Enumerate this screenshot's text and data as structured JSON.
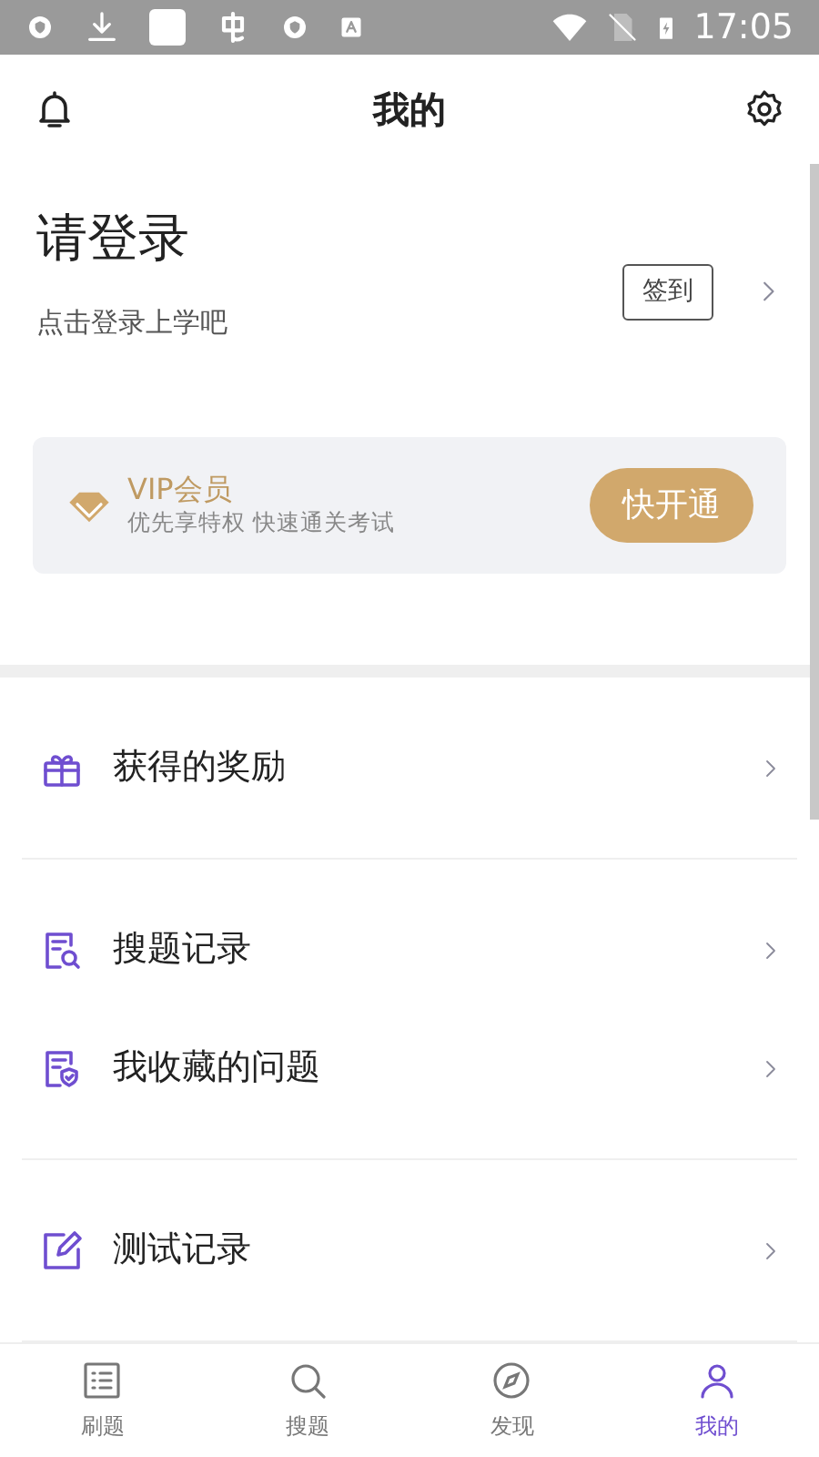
{
  "status_bar": {
    "time": "17:05"
  },
  "header": {
    "title": "我的"
  },
  "profile": {
    "title": "请登录",
    "subtitle": "点击登录上学吧",
    "checkin": "签到"
  },
  "vip": {
    "title": "VIP会员",
    "subtitle": "优先享特权 快速通关考试",
    "button": "快开通"
  },
  "menu_groups": [
    [
      {
        "kind": "gift",
        "label": "获得的奖励"
      }
    ],
    [
      {
        "kind": "search-doc",
        "label": "搜题记录"
      },
      {
        "kind": "shield-doc",
        "label": "我收藏的问题"
      }
    ],
    [
      {
        "kind": "edit",
        "label": "测试记录"
      }
    ]
  ],
  "tabs": [
    {
      "kind": "list",
      "label": "刷题",
      "selected": false
    },
    {
      "kind": "search",
      "label": "搜题",
      "selected": false
    },
    {
      "kind": "compass",
      "label": "发现",
      "selected": false
    },
    {
      "kind": "person",
      "label": "我的",
      "selected": true
    }
  ]
}
